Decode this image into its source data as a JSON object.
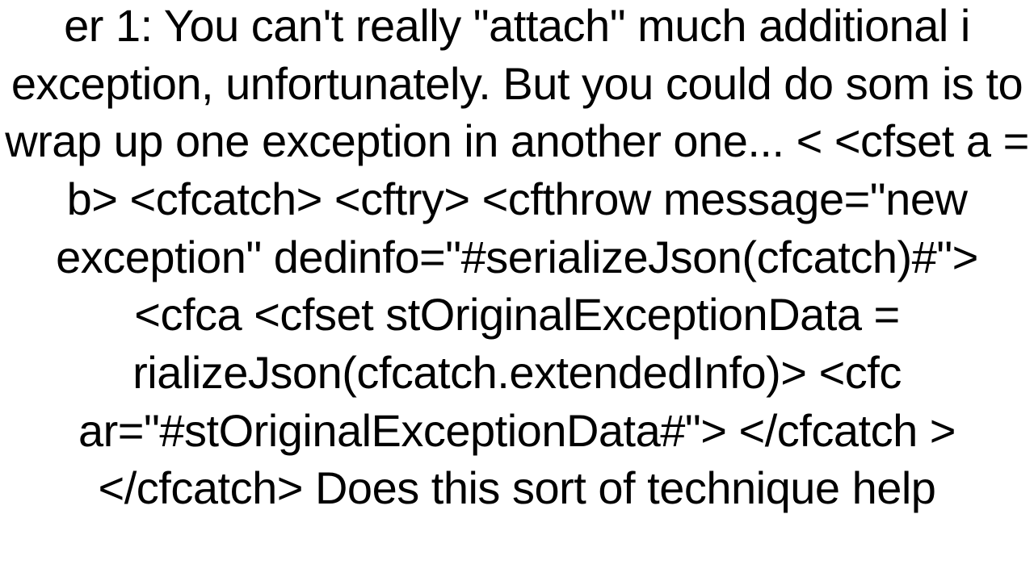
{
  "document": {
    "text": "er 1: You can't really \"attach\" much additional i exception, unfortunately.  But you could do som is to wrap up one exception in another one... <  <cfset a = b> <cfcatch>     <cftry>         <cfthrow message=\"new exception\" dedinfo=\"#serializeJson(cfcatch)#\">         <cfca <cfset stOriginalExceptionData = rializeJson(cfcatch.extendedInfo)>             <cfc ar=\"#stOriginalExceptionData#\">         </cfcatch > </cfcatch>   Does this sort of technique help"
  }
}
